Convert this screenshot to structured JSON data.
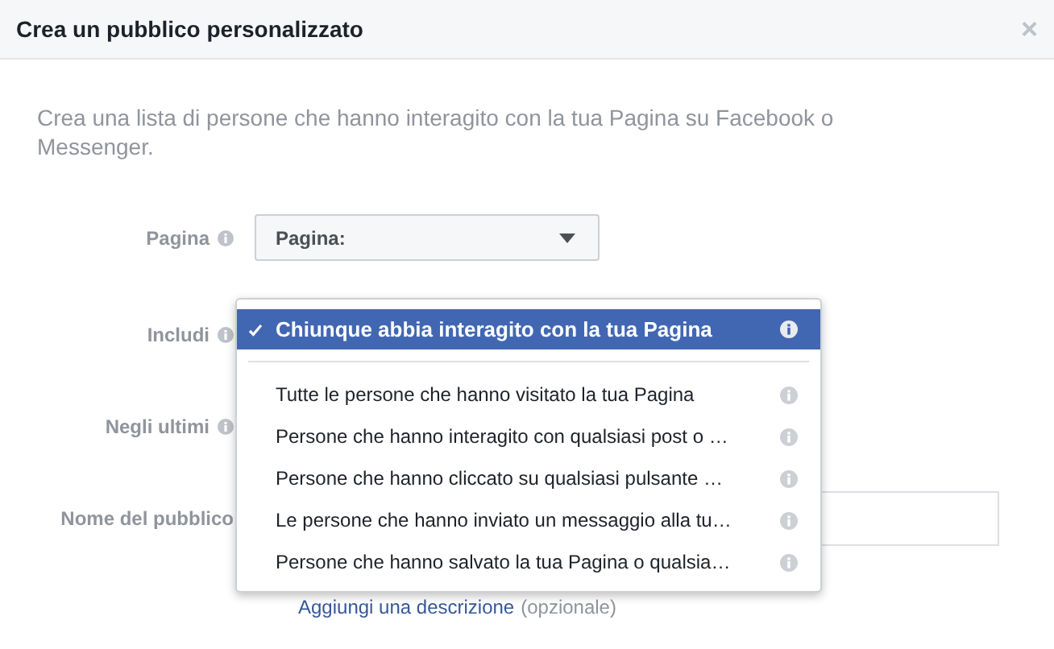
{
  "dialog": {
    "title": "Crea un pubblico personalizzato",
    "close": "×",
    "description": "Crea una lista di persone che hanno interagito con la tua Pagina su Facebook o Messenger.",
    "fields": [
      {
        "label": "Pagina",
        "kind": "select",
        "value": "Pagina:"
      },
      {
        "label": "Includi",
        "kind": "hidden"
      },
      {
        "label": "Negli ultimi",
        "kind": "hidden"
      },
      {
        "label": "Nome del pubblico",
        "kind": "text"
      }
    ],
    "link": "Aggiungi una descrizione",
    "link_note": "(opzionale)",
    "menu": [
      {
        "label": "Chiunque abbia interagito con la tua Pagina",
        "selected": true
      },
      {
        "label": "Tutte le persone che hanno visitato la tua Pagina",
        "selected": false
      },
      {
        "label": "Persone che hanno interagito con qualsiasi post o …",
        "selected": false
      },
      {
        "label": "Persone che hanno cliccato su qualsiasi pulsante …",
        "selected": false
      },
      {
        "label": "Le persone che hanno inviato un messaggio alla tu…",
        "selected": false
      },
      {
        "label": "Persone che hanno salvato la tua Pagina o qualsia…",
        "selected": false
      }
    ]
  }
}
